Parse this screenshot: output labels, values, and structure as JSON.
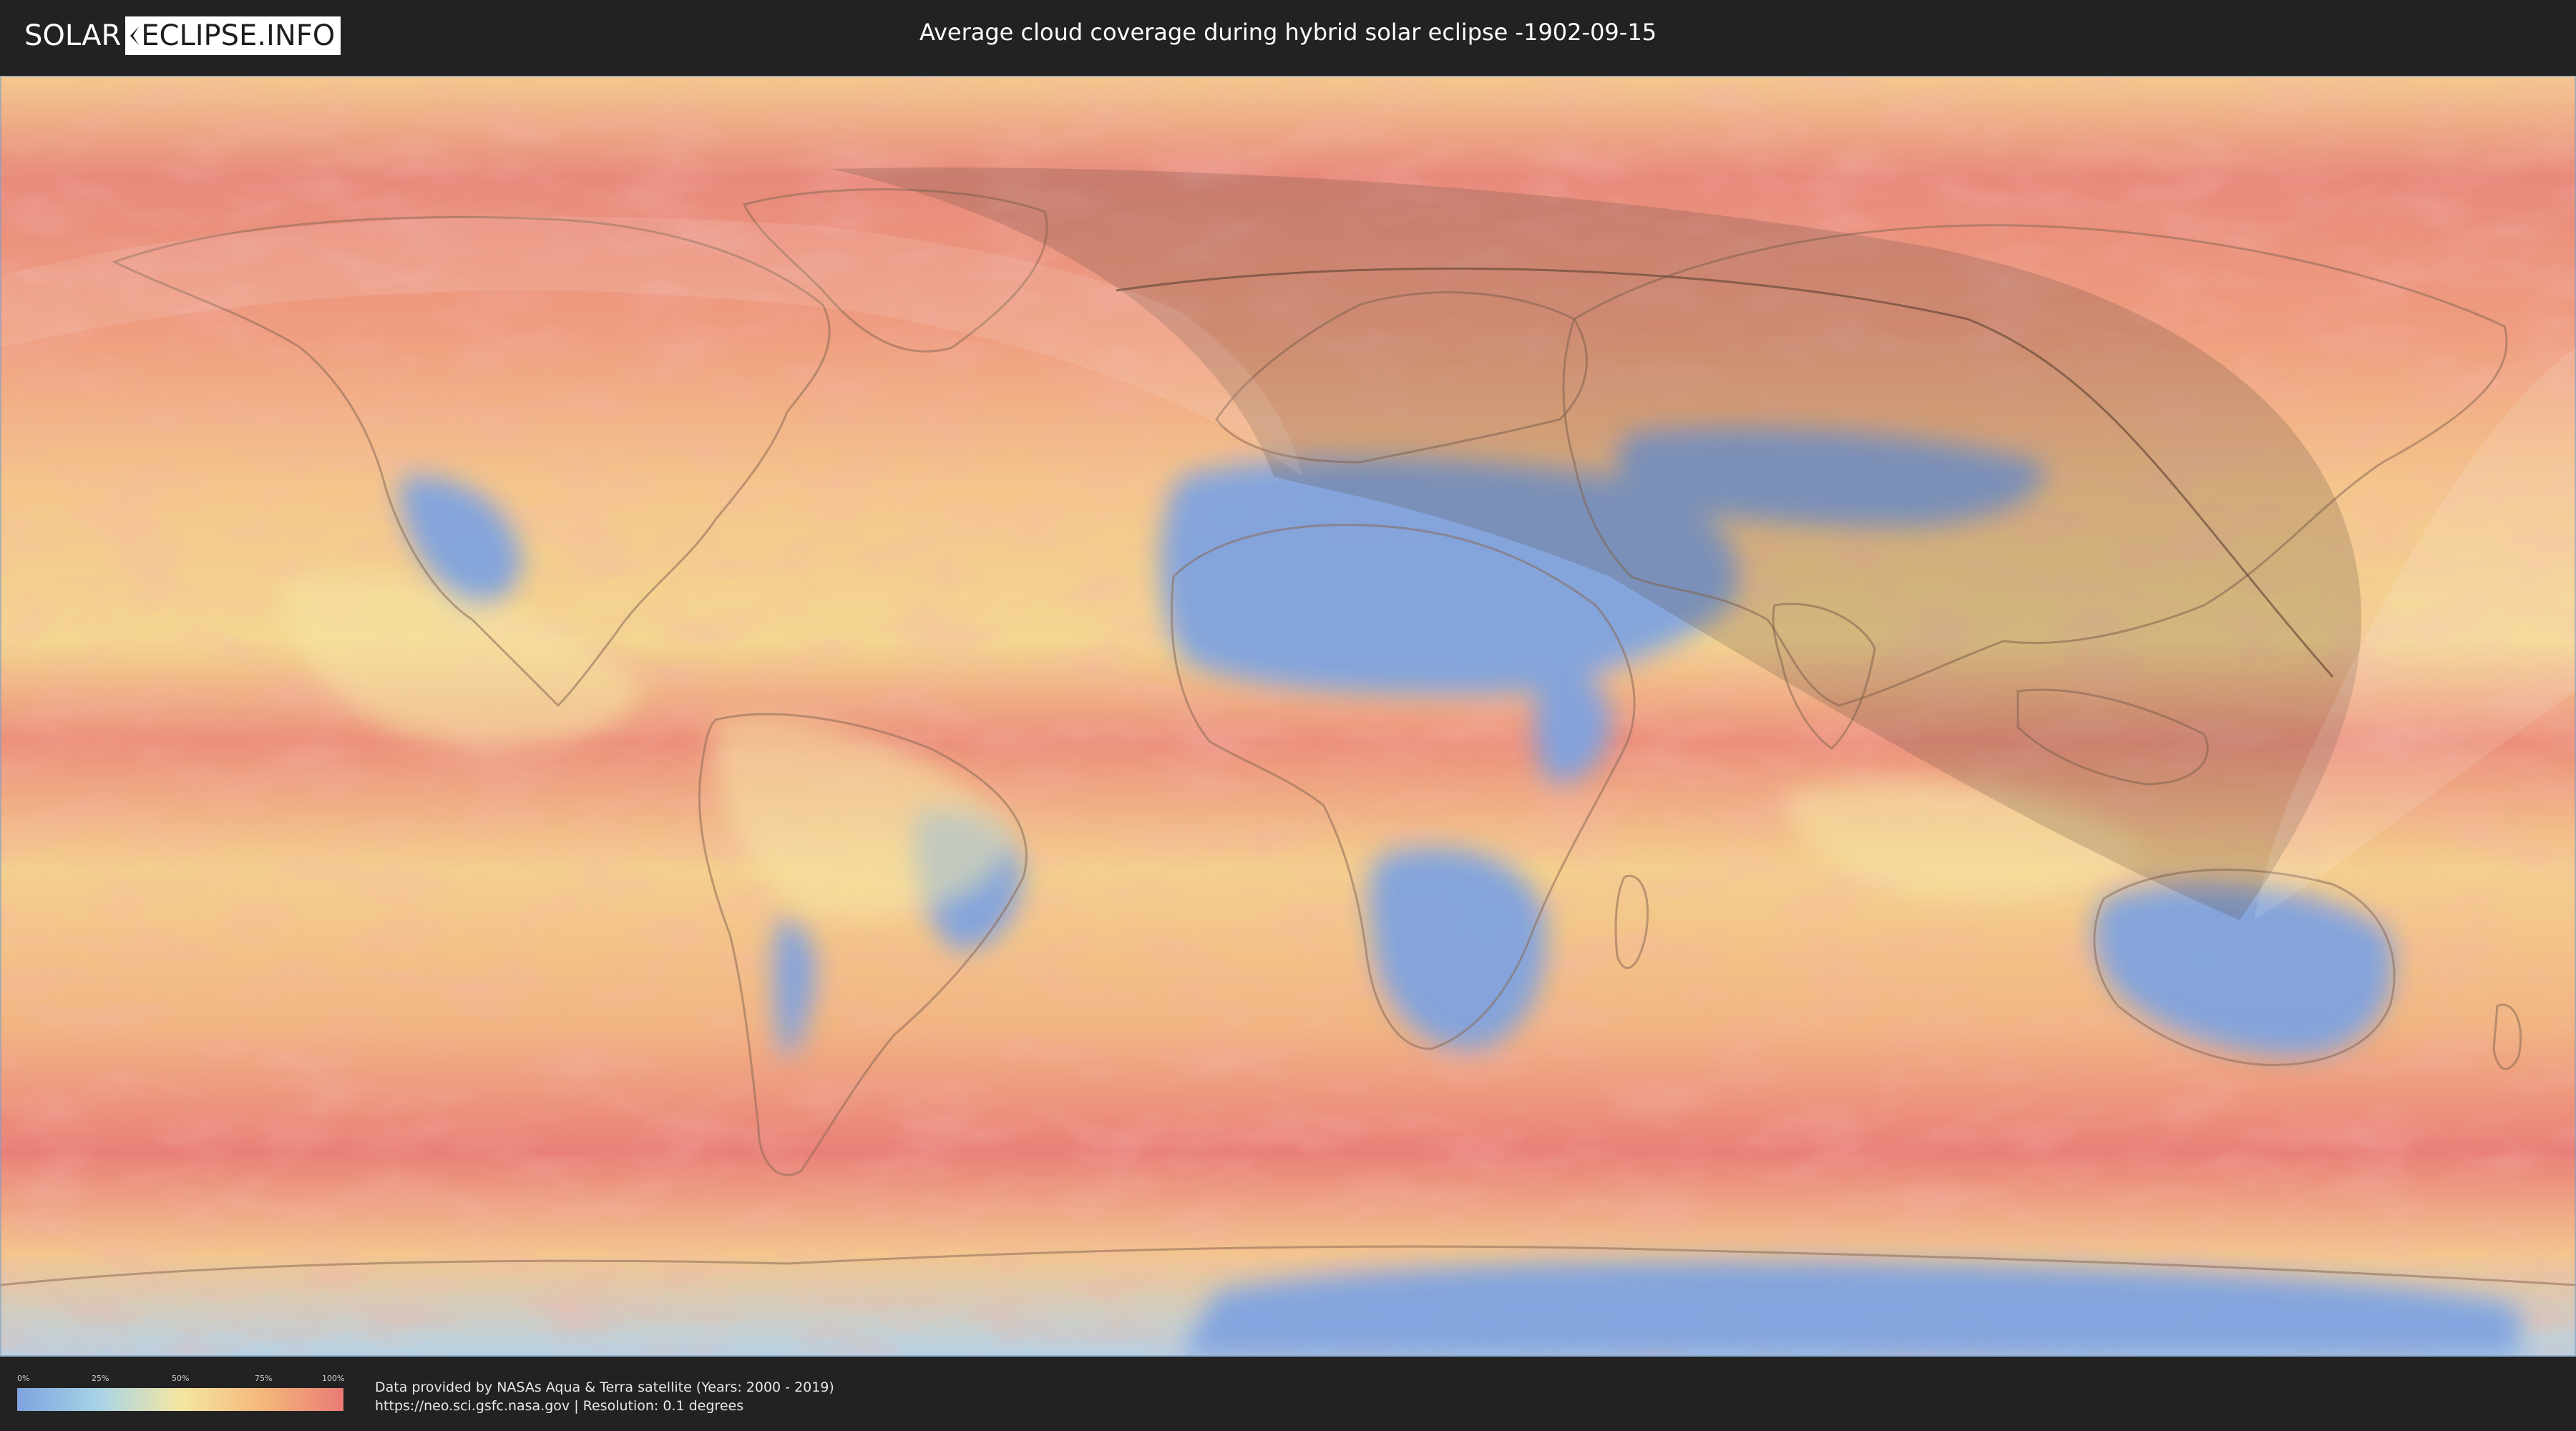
{
  "header": {
    "logo_left": "SOLAR",
    "logo_right": "ECLIPSE.INFO",
    "title": "Average cloud coverage during hybrid solar eclipse -1902-09-15"
  },
  "legend": {
    "ticks": [
      "0%",
      "25%",
      "50%",
      "75%",
      "100%"
    ],
    "colors": [
      "#7fa3e0",
      "#a8d3e6",
      "#f4e6a2",
      "#f4b87a",
      "#ea7b75"
    ]
  },
  "footer": {
    "credit_line1": "Data provided by NASAs Aqua & Terra satellite (Years: 2000 - 2019)",
    "credit_line2": "https://neo.sci.gsfc.nasa.gov | Resolution: 0.1 degrees"
  },
  "map": {
    "projection": "equirectangular",
    "base_cloud_color": "#ee9a7c",
    "land_outline_color": "#8a6a55",
    "eclipse_shadow_color": "#5a4a3a",
    "clear_sky_color": "#7fa3e0"
  }
}
